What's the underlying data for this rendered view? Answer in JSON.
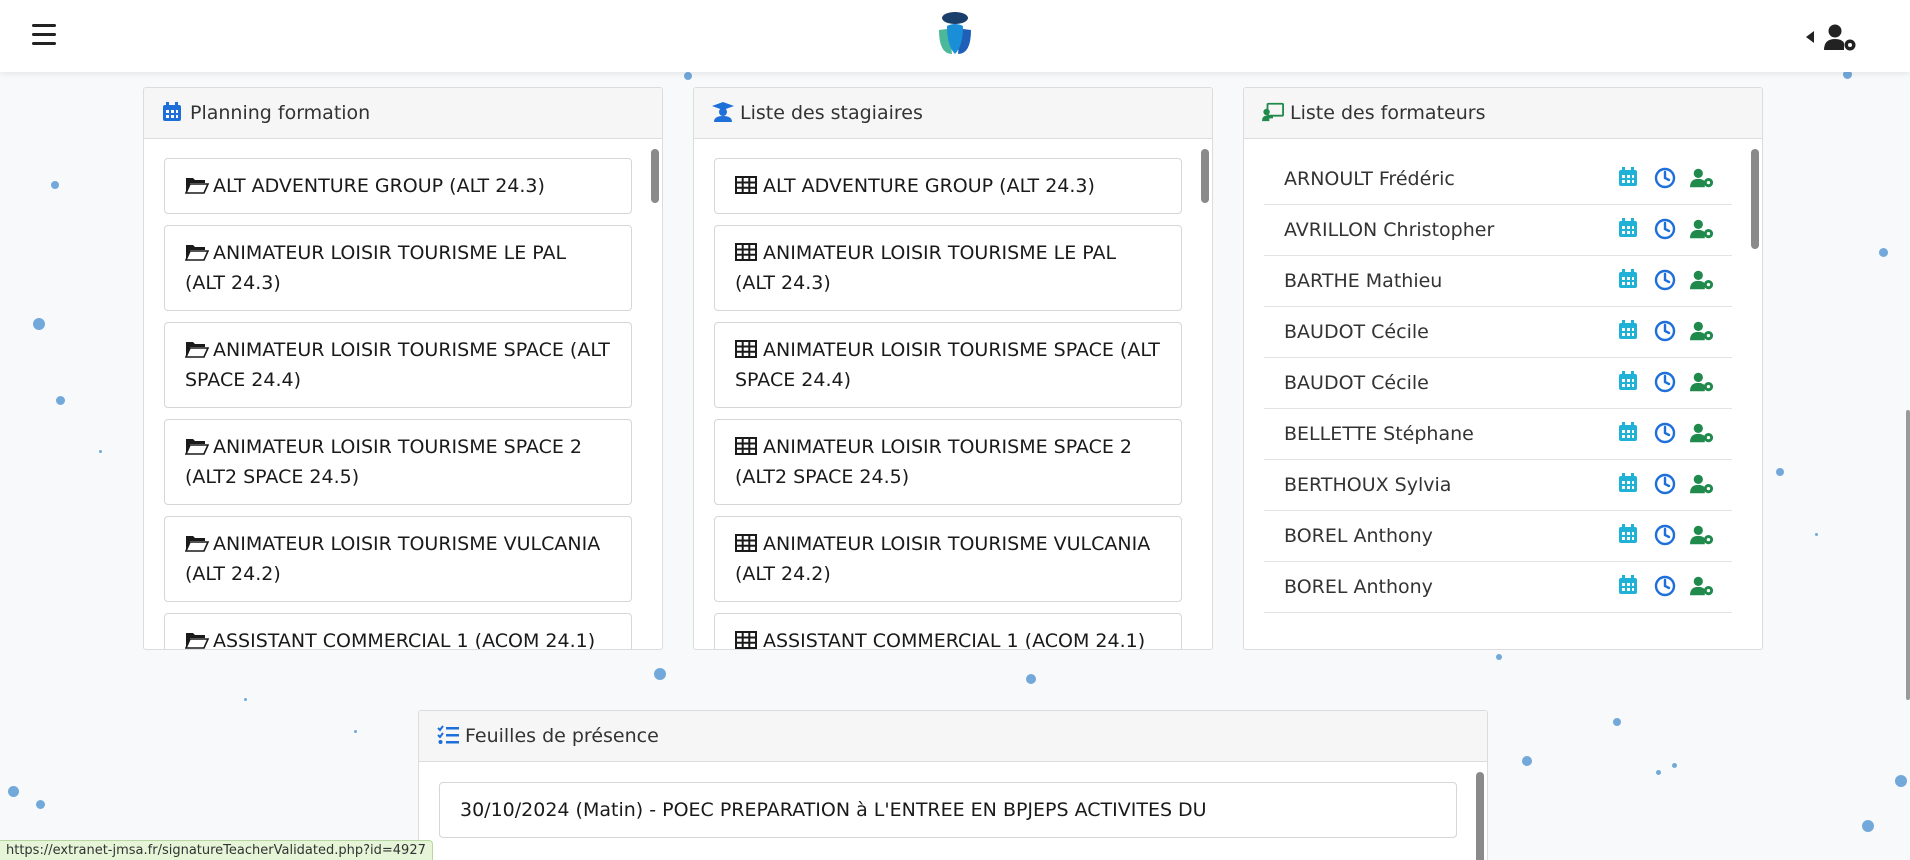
{
  "colors": {
    "accent_blue": "#1e6fd9",
    "accent_teal": "#1fb2d6",
    "accent_green": "#1f8a4c",
    "dot": "#5a9bd4"
  },
  "navbar": {
    "menu_icon": "hamburger-icon",
    "logo": "logo",
    "user_icon": "user-gear-icon"
  },
  "planning": {
    "title": "Planning formation",
    "icon": "calendar-icon",
    "items": [
      {
        "label": "ALT ADVENTURE GROUP (ALT 24.3)"
      },
      {
        "label": "ANIMATEUR LOISIR TOURISME LE PAL (ALT 24.3)"
      },
      {
        "label": "ANIMATEUR LOISIR TOURISME SPACE (ALT SPACE 24.4)"
      },
      {
        "label": "ANIMATEUR LOISIR TOURISME SPACE 2 (ALT2 SPACE 24.5)"
      },
      {
        "label": "ANIMATEUR LOISIR TOURISME VULCANIA (ALT 24.2)"
      },
      {
        "label": "ASSISTANT COMMERCIAL 1 (ACOM 24.1)"
      }
    ]
  },
  "stagiaires": {
    "title": "Liste des stagiaires",
    "icon": "graduate-icon",
    "items": [
      {
        "label": "ALT ADVENTURE GROUP (ALT 24.3)"
      },
      {
        "label": "ANIMATEUR LOISIR TOURISME LE PAL (ALT 24.3)"
      },
      {
        "label": "ANIMATEUR LOISIR TOURISME SPACE (ALT SPACE 24.4)"
      },
      {
        "label": "ANIMATEUR LOISIR TOURISME SPACE 2 (ALT2 SPACE 24.5)"
      },
      {
        "label": "ANIMATEUR LOISIR TOURISME VULCANIA (ALT 24.2)"
      },
      {
        "label": "ASSISTANT COMMERCIAL 1 (ACOM 24.1)"
      }
    ]
  },
  "formateurs": {
    "title": "Liste des formateurs",
    "icon": "teacher-board-icon",
    "items": [
      {
        "name": "ARNOULT Frédéric"
      },
      {
        "name": "AVRILLON Christopher"
      },
      {
        "name": "BARTHE Mathieu"
      },
      {
        "name": "BAUDOT Cécile"
      },
      {
        "name": "BAUDOT Cécile"
      },
      {
        "name": "BELLETTE Stéphane"
      },
      {
        "name": "BERTHOUX Sylvia"
      },
      {
        "name": "BOREL Anthony"
      },
      {
        "name": "BOREL Anthony"
      }
    ]
  },
  "presence": {
    "title": "Feuilles de présence",
    "icon": "checklist-icon",
    "items": [
      {
        "label": "30/10/2024 (Matin) - POEC PREPARATION à L'ENTREE EN BPJEPS ACTIVITES DU"
      }
    ]
  },
  "statusbar": {
    "url": "https://extranet-jmsa.fr/signatureTeacherValidated.php?id=4927"
  }
}
